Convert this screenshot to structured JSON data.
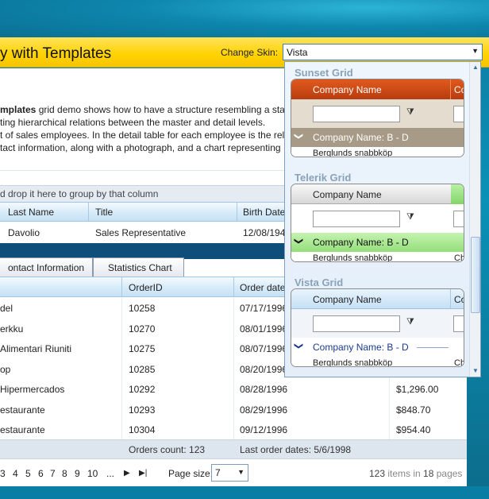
{
  "header": {
    "title": "y with Templates",
    "change_skin_label": "Change Skin:",
    "skin_selected": "Vista"
  },
  "description": {
    "line1_bold": "mplates",
    "line1_rest": " grid demo shows how to have a structure resembling a stan",
    "line2": "ting hierarchical relations between the master and detail levels.",
    "line3": "t of sales employees. In the detail table for each employee is the rele",
    "line4": "tact information, along with a photograph, and a chart representing"
  },
  "group_panel": "d drop it here to group by that column",
  "master": {
    "columns": [
      "Last Name",
      "Title",
      "Birth Date"
    ],
    "row": {
      "last_name": "Davolio",
      "title": "Sales Representative",
      "birth": "12/08/194"
    }
  },
  "tabs": [
    "ontact Information",
    "Statistics Chart"
  ],
  "detail": {
    "columns": [
      "OrderID",
      "Order date"
    ],
    "rows": [
      {
        "name": "del",
        "id": "10258",
        "date": "07/17/1996",
        "amount": ""
      },
      {
        "name": "erkku",
        "id": "10270",
        "date": "08/01/1996",
        "amount": ""
      },
      {
        "name": " Alimentari Riuniti",
        "id": "10275",
        "date": "08/07/1996",
        "amount": ""
      },
      {
        "name": "op",
        "id": "10285",
        "date": "08/20/1996",
        "amount": ""
      },
      {
        "name": "Hipermercados",
        "id": "10292",
        "date": "08/28/1996",
        "amount": "$1,296.00"
      },
      {
        "name": "estaurante",
        "id": "10293",
        "date": "08/29/1996",
        "amount": "$848.70"
      },
      {
        "name": "estaurante",
        "id": "10304",
        "date": "09/12/1996",
        "amount": "$954.40"
      }
    ],
    "footer_count": "Orders count: 123",
    "footer_last": "Last order dates: 5/6/1998"
  },
  "pager": {
    "pages": [
      "3",
      "4",
      "5",
      "6",
      "7",
      "8",
      "9",
      "10",
      "..."
    ],
    "next": "▶",
    "last": "▶|",
    "page_size_label": "Page size:",
    "page_size": "7",
    "items_total": "123",
    "items_mid": " items in ",
    "pages_total": "18",
    "pages_word": " pages"
  },
  "skins": [
    {
      "name": "Sunset Grid",
      "header_text": "Company Name",
      "header_right": "Co",
      "group_text": "Company Name: B - D",
      "row_text": "Berglunds snabbköp",
      "row_right": ""
    },
    {
      "name": "Telerik Grid",
      "header_text": "Company Name",
      "header_right": "",
      "group_text": "Company Name: B - D",
      "row_text": "Berglunds snabbköp",
      "row_right": "Ch"
    },
    {
      "name": "Vista Grid",
      "header_text": "Company Name",
      "header_right": "Co",
      "group_text": "Company Name: B - D",
      "row_text": "Berglunds snabbköp",
      "row_right": "Ch"
    }
  ],
  "icons": {
    "dropdown_arrow": "▼",
    "filter": "⧩",
    "chevron": "❯"
  },
  "colors": {
    "title_bar": "#ffd200",
    "sunset_header": "#c84a14",
    "telerik_group": "#a6e39a",
    "vista_header": "#cfe6f8"
  }
}
